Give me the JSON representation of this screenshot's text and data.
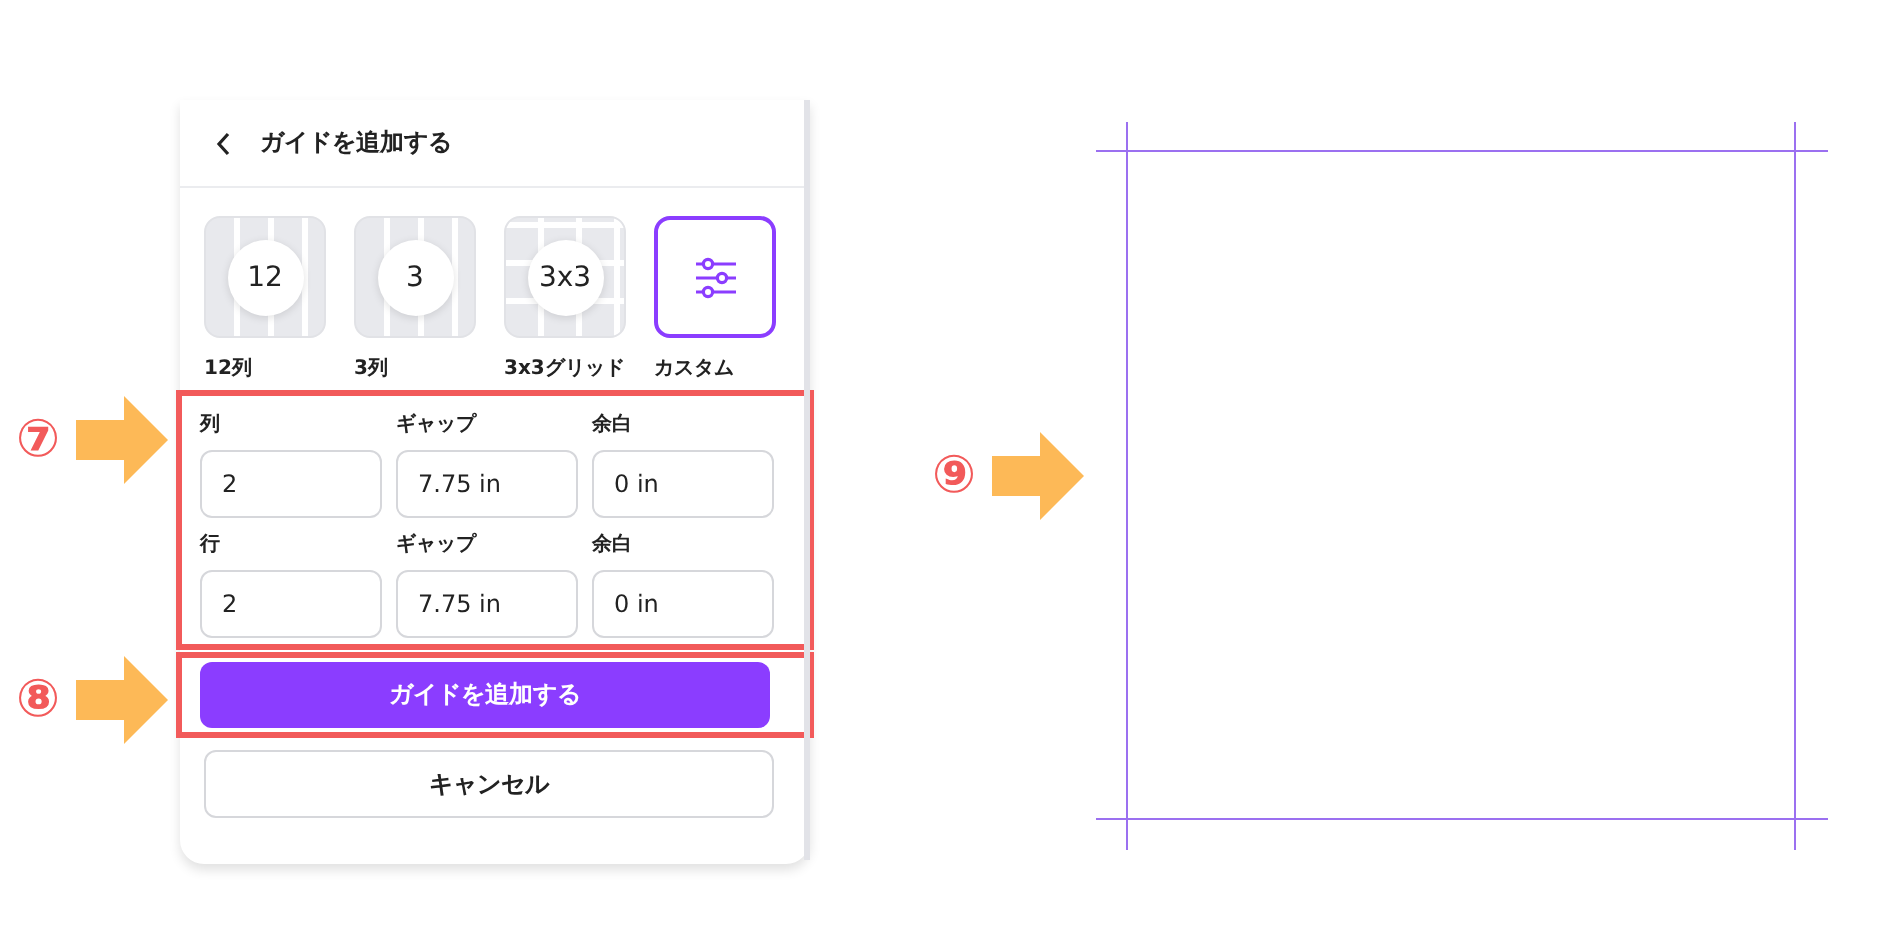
{
  "panel": {
    "title": "ガイドを追加する",
    "presets": [
      {
        "kind": "columns",
        "badge": "12",
        "label": "12列",
        "selected": false
      },
      {
        "kind": "columns",
        "badge": "3",
        "label": "3列",
        "selected": false
      },
      {
        "kind": "grid",
        "badge": "3x3",
        "label": "3x3グリッド",
        "selected": false
      },
      {
        "kind": "custom",
        "label": "カスタム",
        "selected": true
      }
    ],
    "field_rows": [
      {
        "fields": [
          {
            "label": "列",
            "value": "2"
          },
          {
            "label": "ギャップ",
            "value": "7.75 in"
          },
          {
            "label": "余白",
            "value": "0 in"
          }
        ]
      },
      {
        "fields": [
          {
            "label": "行",
            "value": "2"
          },
          {
            "label": "ギャップ",
            "value": "7.75 in"
          },
          {
            "label": "余白",
            "value": "0 in"
          }
        ]
      }
    ],
    "buttons": [
      {
        "kind": "primary",
        "label": "ガイドを追加する"
      },
      {
        "kind": "secondary",
        "label": "キャンセル"
      }
    ]
  },
  "annotations": [
    {
      "number": "⑦"
    },
    {
      "number": "⑧"
    },
    {
      "number": "⑨"
    }
  ]
}
